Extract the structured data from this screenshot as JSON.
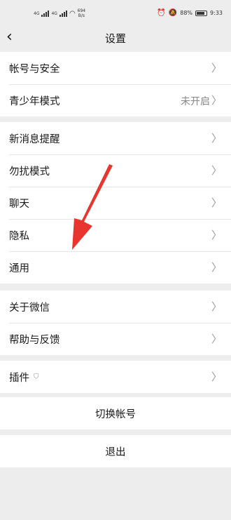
{
  "statusbar": {
    "sim1": "4G",
    "sim2": "4G",
    "speed_value": "694",
    "speed_unit": "B/s",
    "battery": "88%",
    "time": "9:33"
  },
  "nav": {
    "back_icon": "chevron-left-icon",
    "title": "设置"
  },
  "groups": [
    {
      "items": [
        {
          "label": "帐号与安全"
        },
        {
          "label": "青少年模式",
          "value": "未开启"
        }
      ]
    },
    {
      "items": [
        {
          "label": "新消息提醒"
        },
        {
          "label": "勿扰模式"
        },
        {
          "label": "聊天"
        },
        {
          "label": "隐私"
        },
        {
          "label": "通用"
        }
      ]
    },
    {
      "items": [
        {
          "label": "关于微信"
        },
        {
          "label": "帮助与反馈"
        }
      ]
    },
    {
      "items": [
        {
          "label": "插件"
        }
      ]
    }
  ],
  "actions": {
    "switch_account": "切换帐号",
    "logout": "退出"
  },
  "annotation": {
    "color": "#e8352e"
  },
  "icons": {
    "chevron": "chevron-right-icon",
    "plugin_badge": "shield-icon"
  }
}
